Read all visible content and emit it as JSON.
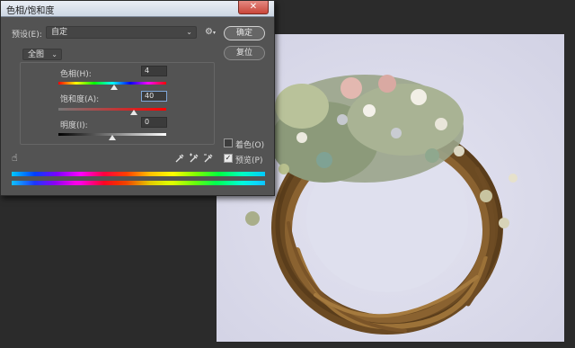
{
  "dialog": {
    "title": "色相/饱和度",
    "close_label": "✕",
    "preset_label": "预设(E):",
    "preset_value": "自定",
    "channel_value": "全图",
    "hue_label": "色相(H):",
    "hue_value": "4",
    "saturation_label": "饱和度(A):",
    "saturation_value": "40",
    "lightness_label": "明度(I):",
    "lightness_value": "0",
    "ok_label": "确定",
    "reset_label": "复位",
    "colorize_label": "着色(O)",
    "preview_label": "预览(P)",
    "colorize_checked": false,
    "preview_checked": true
  },
  "icons": [
    "gear-icon",
    "hand-icon",
    "eyedropper-icon",
    "eyedropper-plus-icon",
    "eyedropper-minus-icon",
    "close-icon"
  ],
  "colors": {
    "dialog_bg": "#535353",
    "workspace_bg": "#2b2b2b",
    "canvas_bg": "#dcdced",
    "close_button": "#c9463a"
  }
}
